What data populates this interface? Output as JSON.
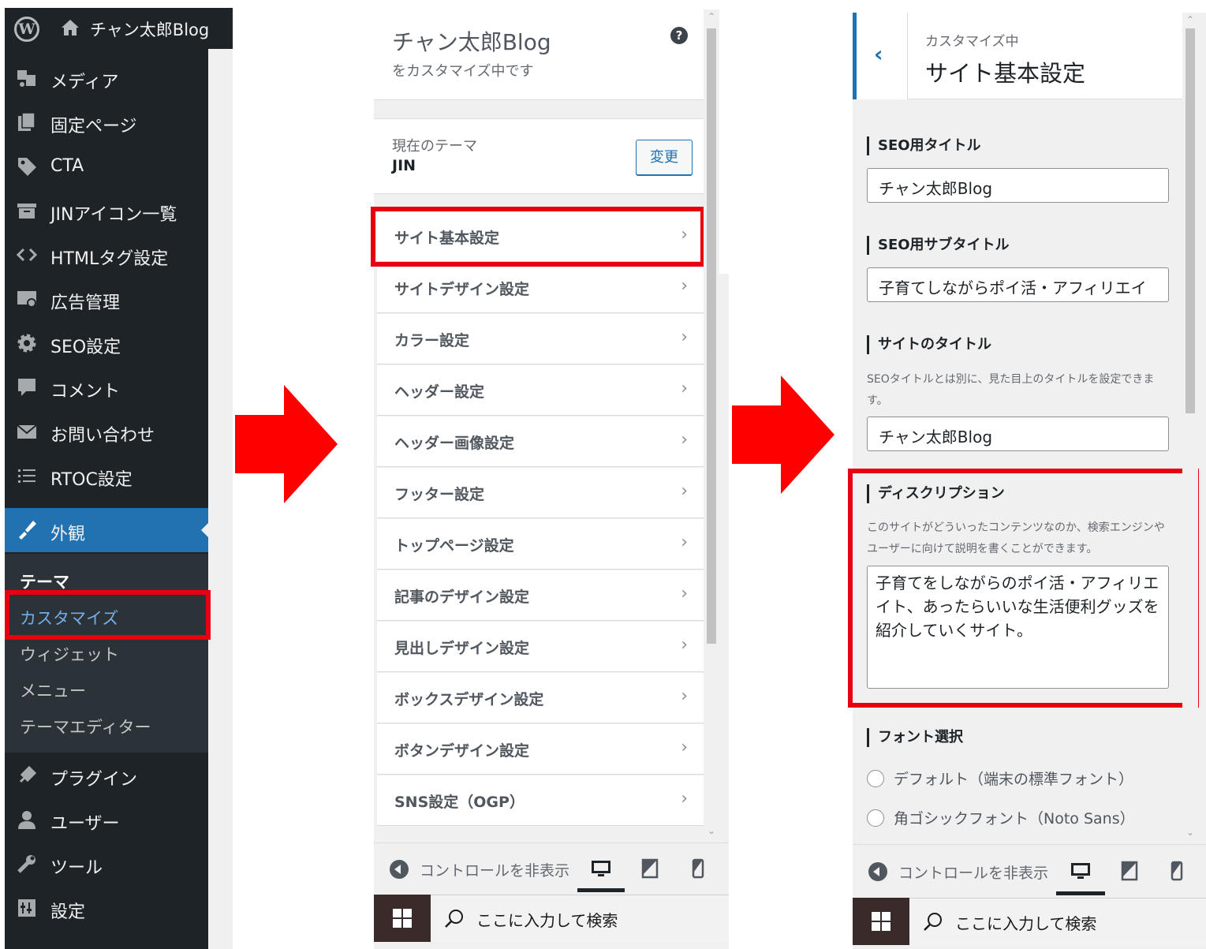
{
  "colors": {
    "highlight": "#e60012",
    "wp_blue": "#2271b1",
    "admin_dark": "#1d2327",
    "arrow_red": "#ff0000"
  },
  "admin": {
    "site_name": "チャン太郎Blog",
    "menu": [
      {
        "label": "メディア",
        "icon": "media-icon"
      },
      {
        "label": "固定ページ",
        "icon": "pages-icon"
      },
      {
        "label": "CTA",
        "icon": "tag-icon"
      },
      {
        "label": "JINアイコン一覧",
        "icon": "archive-icon"
      },
      {
        "label": "HTMLタグ設定",
        "icon": "code-icon"
      },
      {
        "label": "広告管理",
        "icon": "ads-icon"
      },
      {
        "label": "SEO設定",
        "icon": "gear-icon"
      },
      {
        "label": "コメント",
        "icon": "comment-icon"
      },
      {
        "label": "お問い合わせ",
        "icon": "mail-icon"
      },
      {
        "label": "RTOC設定",
        "icon": "list-icon"
      }
    ],
    "active_menu": {
      "label": "外観",
      "icon": "brush-icon"
    },
    "submenu": [
      "テーマ",
      "カスタマイズ",
      "ウィジェット",
      "メニュー",
      "テーマエディター"
    ],
    "menu_after": [
      {
        "label": "プラグイン",
        "icon": "plugin-icon"
      },
      {
        "label": "ユーザー",
        "icon": "user-icon"
      },
      {
        "label": "ツール",
        "icon": "wrench-icon"
      },
      {
        "label": "設定",
        "icon": "settings-icon"
      }
    ]
  },
  "customizer": {
    "title": "チャン太郎Blog",
    "subtitle": "をカスタマイズ中です",
    "help_icon": "?",
    "theme_label": "現在のテーマ",
    "theme_name": "JIN",
    "change_button": "変更",
    "sections": [
      "サイト基本設定",
      "サイトデザイン設定",
      "カラー設定",
      "ヘッダー設定",
      "ヘッダー画像設定",
      "フッター設定",
      "トップページ設定",
      "記事のデザイン設定",
      "見出しデザイン設定",
      "ボックスデザイン設定",
      "ボタンデザイン設定",
      "SNS設定（OGP）"
    ],
    "chevron": "›",
    "footer": {
      "hide_controls": "コントロールを非表示"
    },
    "taskbar": {
      "search_placeholder": "ここに入力して検索"
    }
  },
  "settings_panel": {
    "back": "‹",
    "breadcrumb": "カスタマイズ中",
    "title": "サイト基本設定",
    "seo_title_label": "SEO用タイトル",
    "seo_title_value": "チャン太郎Blog",
    "seo_subtitle_label": "SEO用サブタイトル",
    "seo_subtitle_value": "子育てしながらポイ活・アフィリエイ",
    "site_title_label": "サイトのタイトル",
    "site_title_desc": "SEOタイトルとは別に、見た目上のタイトルを設定できます。",
    "site_title_value": "チャン太郎Blog",
    "description_label": "ディスクリプション",
    "description_desc": "このサイトがどういったコンテンツなのか、検索エンジンやユーザーに向けて説明を書くことができます。",
    "description_value": "子育てをしながらのポイ活・アフィリエイト、あったらいいな生活便利グッズを紹介していくサイト。",
    "font_label": "フォント選択",
    "font_options": [
      "デフォルト（端末の標準フォント）",
      "角ゴシックフォント（Noto Sans）"
    ],
    "footer": {
      "hide_controls": "コントロールを非表示"
    },
    "taskbar": {
      "search_placeholder": "ここに入力して検索"
    }
  }
}
